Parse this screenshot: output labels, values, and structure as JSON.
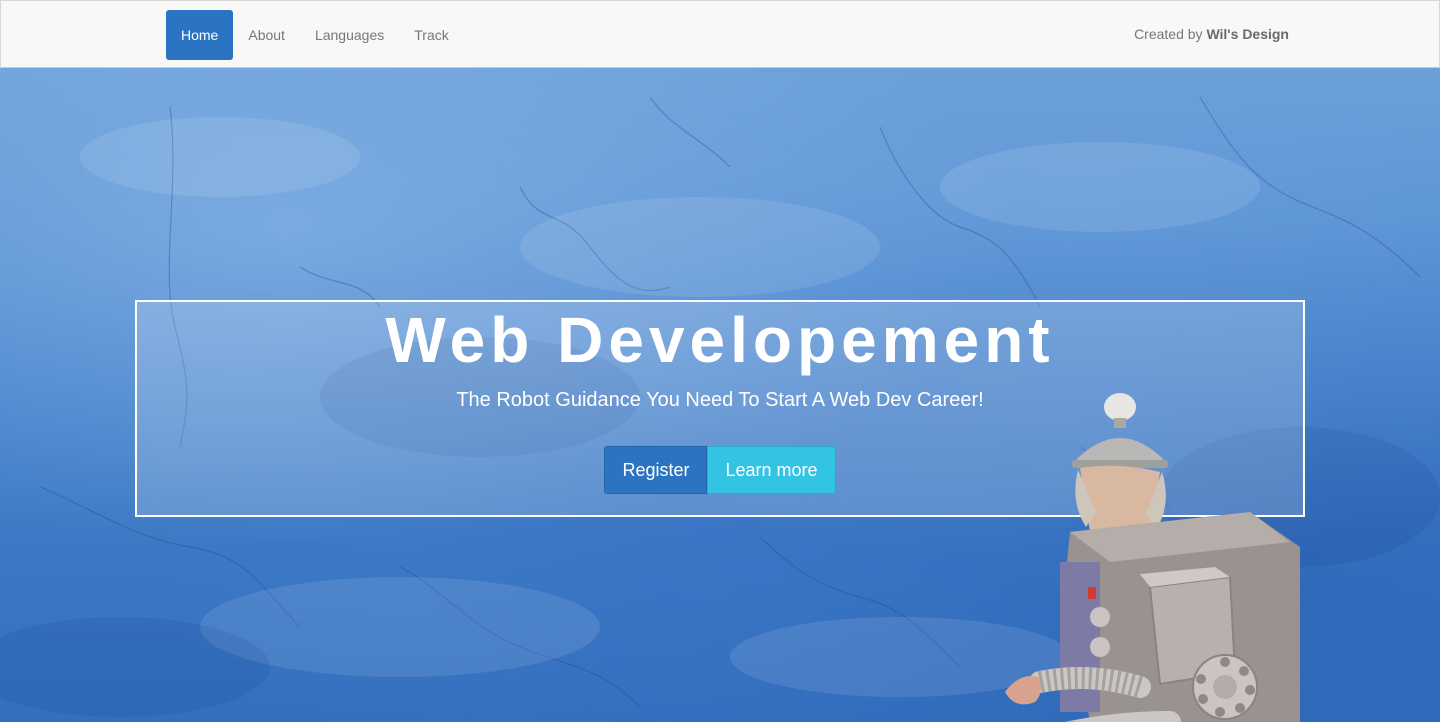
{
  "nav": {
    "items": [
      {
        "label": "Home",
        "active": true
      },
      {
        "label": "About",
        "active": false
      },
      {
        "label": "Languages",
        "active": false
      },
      {
        "label": "Track",
        "active": false
      }
    ],
    "credit_prefix": "Created by",
    "credit_name": "Wil's Design"
  },
  "hero": {
    "title": "Web Developement",
    "subtitle": "The Robot Guidance You Need To Start A Web Dev Career!",
    "register_label": "Register",
    "learn_more_label": "Learn more"
  },
  "colors": {
    "primary": "#2a74c2",
    "info": "#33c3e3",
    "navbar_bg": "#f8f8f8",
    "hero_blue": "#4c88cf"
  },
  "icons": {
    "robot": "robot-costume-illustration"
  }
}
